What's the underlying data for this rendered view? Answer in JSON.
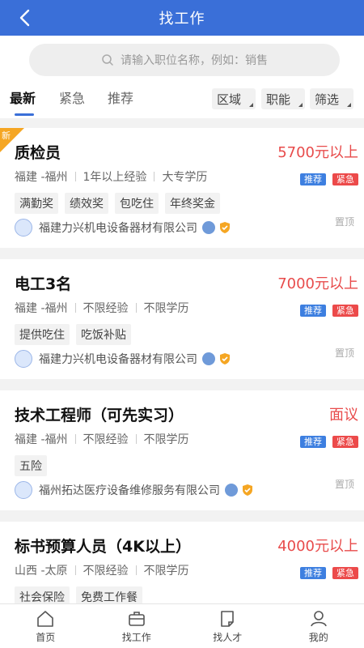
{
  "header": {
    "title": "找工作"
  },
  "search": {
    "placeholder": "请输入职位名称，例如：销售"
  },
  "tabs": [
    {
      "label": "最新",
      "active": true
    },
    {
      "label": "紧急",
      "active": false
    },
    {
      "label": "推荐",
      "active": false
    }
  ],
  "filters": [
    "区域",
    "职能",
    "筛选"
  ],
  "jobs": [
    {
      "is_new": true,
      "new_label": "新",
      "title": "质检员",
      "salary": "5700元以上",
      "location": "福建 -福州",
      "experience": "1年以上经验",
      "education": "大专学历",
      "tag_recommend": "推荐",
      "tag_urgent": "紧急",
      "benefits": [
        "满勤奖",
        "绩效奖",
        "包吃住",
        "年终奖金"
      ],
      "company": "福建力兴机电设备器材有限公司",
      "top_label": "置顶"
    },
    {
      "is_new": false,
      "title": "电工3名",
      "salary": "7000元以上",
      "location": "福建 -福州",
      "experience": "不限经验",
      "education": "不限学历",
      "tag_recommend": "推荐",
      "tag_urgent": "紧急",
      "benefits": [
        "提供吃住",
        "吃饭补贴"
      ],
      "company": "福建力兴机电设备器材有限公司",
      "top_label": "置顶"
    },
    {
      "is_new": false,
      "title": "技术工程师（可先实习）",
      "salary": "面议",
      "location": "福建 -福州",
      "experience": "不限经验",
      "education": "不限学历",
      "tag_recommend": "推荐",
      "tag_urgent": "紧急",
      "benefits": [
        "五险"
      ],
      "company": "福州拓达医疗设备维修服务有限公司",
      "top_label": "置顶"
    },
    {
      "is_new": false,
      "title": "标书预算人员（4K以上）",
      "salary": "4000元以上",
      "location": "山西 -太原",
      "experience": "不限经验",
      "education": "不限学历",
      "tag_recommend": "推荐",
      "tag_urgent": "紧急",
      "benefits": [
        "社会保险",
        "免费工作餐"
      ],
      "company": "",
      "top_label": ""
    }
  ],
  "tabbar": [
    {
      "label": "首页",
      "icon": "home-icon"
    },
    {
      "label": "找工作",
      "icon": "briefcase-icon"
    },
    {
      "label": "找人才",
      "icon": "document-icon"
    },
    {
      "label": "我的",
      "icon": "user-icon"
    }
  ],
  "colors": {
    "primary": "#3a6fd8",
    "salary": "#e84b4b",
    "tag_recommend": "#3d7fe0",
    "tag_urgent": "#ec4a4a",
    "new_badge": "#f5a623"
  }
}
